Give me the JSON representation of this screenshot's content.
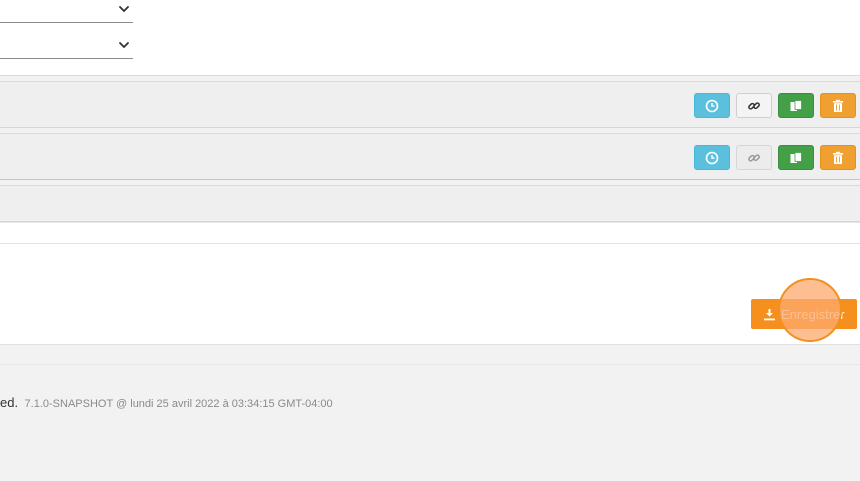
{
  "save_button": {
    "label": "Enregistrer",
    "icon": "download-icon"
  },
  "footer": {
    "text_fragment": "ed.",
    "version": "7.1.0-SNAPSHOT @ lundi 25 avril 2022 à 03:34:15 GMT-04:00"
  },
  "rows": [
    {
      "actions": [
        "clock-icon",
        "link-icon",
        "copy-icon",
        "trash-icon"
      ],
      "link_enabled": true
    },
    {
      "actions": [
        "clock-icon",
        "link-icon",
        "copy-icon",
        "trash-icon"
      ],
      "link_enabled": false
    }
  ],
  "colors": {
    "info": "#5bc0de",
    "success": "#43a047",
    "warning": "#f0a030",
    "accent": "#f5901e"
  }
}
